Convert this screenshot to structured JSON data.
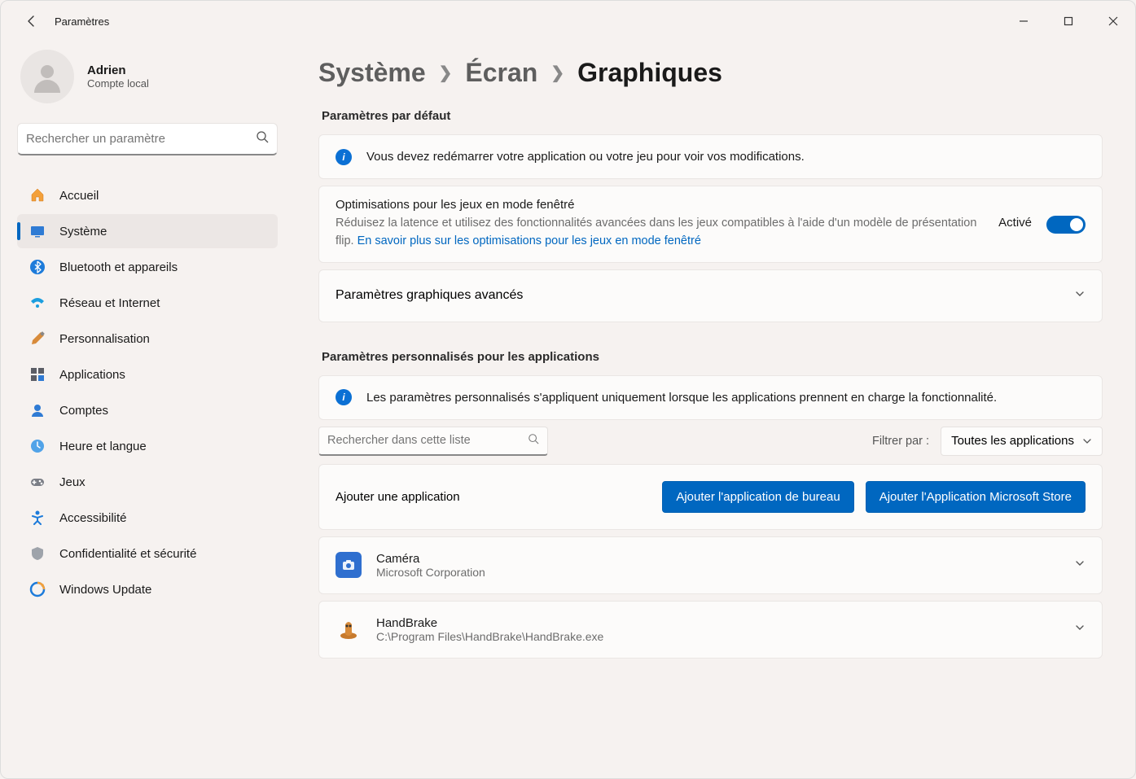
{
  "app_title": "Paramètres",
  "profile": {
    "name": "Adrien",
    "subtitle": "Compte local"
  },
  "search": {
    "placeholder": "Rechercher un paramètre"
  },
  "nav": {
    "home": "Accueil",
    "system": "Système",
    "bluetooth": "Bluetooth et appareils",
    "network": "Réseau et Internet",
    "personalization": "Personnalisation",
    "apps": "Applications",
    "accounts": "Comptes",
    "time": "Heure et langue",
    "gaming": "Jeux",
    "accessibility": "Accessibilité",
    "privacy": "Confidentialité et sécurité",
    "update": "Windows Update"
  },
  "breadcrumb": {
    "level1": "Système",
    "level2": "Écran",
    "level3": "Graphiques"
  },
  "sections": {
    "defaults": "Paramètres par défaut",
    "custom_apps": "Paramètres personnalisés pour les applications"
  },
  "info_restart": "Vous devez redémarrer votre application ou votre jeu pour voir vos modifications.",
  "windowed_opt": {
    "title": "Optimisations pour les jeux en mode fenêtré",
    "desc": "Réduisez la latence et utilisez des fonctionnalités avancées dans les jeux compatibles à l'aide d'un modèle de présentation flip. ",
    "link": "En savoir plus sur les optimisations pour les jeux en mode fenêtré",
    "state": "Activé"
  },
  "advanced": "Paramètres graphiques avancés",
  "info_custom": "Les paramètres personnalisés s'appliquent uniquement lorsque les applications prennent en charge la fonctionnalité.",
  "list_search": {
    "placeholder": "Rechercher dans cette liste"
  },
  "filter": {
    "label": "Filtrer par :",
    "value": "Toutes les applications"
  },
  "add_app": {
    "label": "Ajouter une application",
    "btn_desktop": "Ajouter l'application de bureau",
    "btn_store": "Ajouter l'Application Microsoft Store"
  },
  "apps_list": [
    {
      "name": "Caméra",
      "sub": "Microsoft Corporation",
      "icon_color": "#2f6fcf"
    },
    {
      "name": "HandBrake",
      "sub": "C:\\Program Files\\HandBrake\\HandBrake.exe",
      "icon_color": "#d88b3a"
    }
  ]
}
